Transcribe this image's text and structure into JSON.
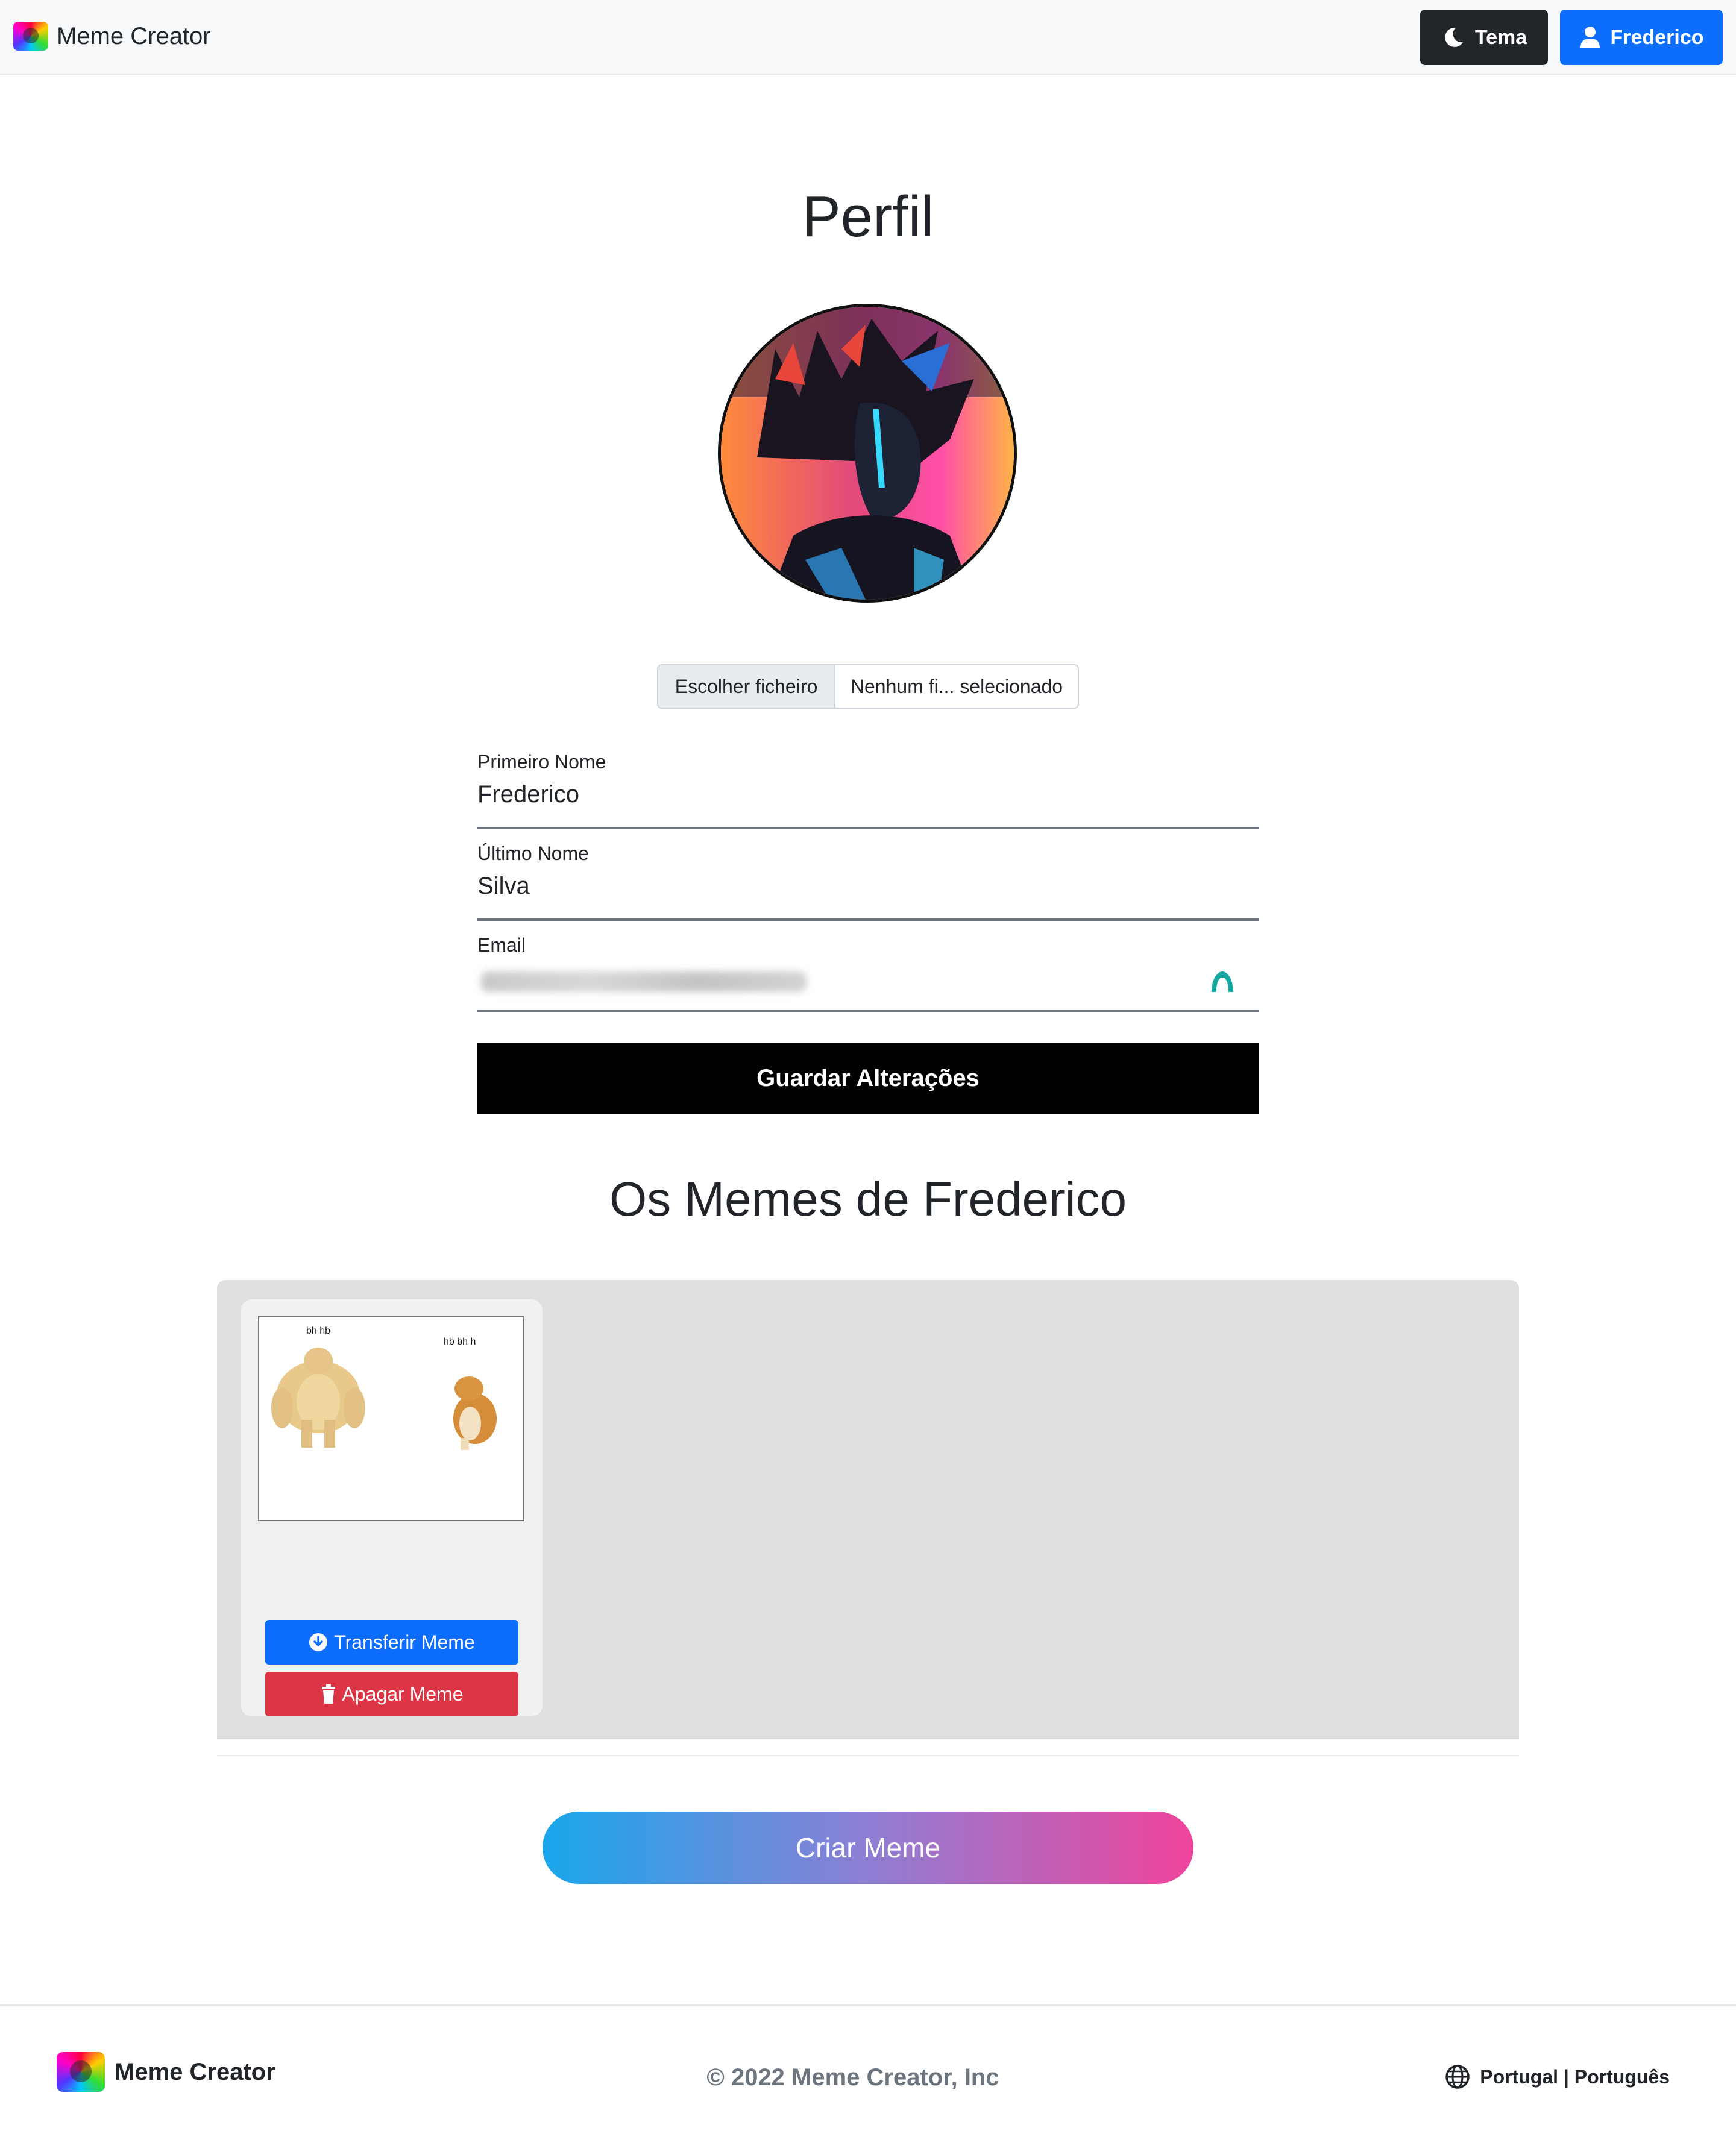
{
  "header": {
    "brand": "Meme Creator",
    "theme_label": "Tema",
    "user_label": "Frederico"
  },
  "profile": {
    "title": "Perfil",
    "file_button": "Escolher ficheiro",
    "file_status": "Nenhum fi... selecionado",
    "first_name_label": "Primeiro Nome",
    "first_name_value": "Frederico",
    "last_name_label": "Último Nome",
    "last_name_value": "Silva",
    "email_label": "Email",
    "save_label": "Guardar Alterações"
  },
  "memes": {
    "title": "Os Memes de Frederico",
    "items": [
      {
        "caption_left": "bh hb",
        "caption_right": "hb bh h",
        "download_label": "Transferir Meme",
        "delete_label": "Apagar Meme"
      }
    ]
  },
  "create_label": "Criar Meme",
  "footer": {
    "brand": "Meme Creator",
    "copyright": "© 2022 Meme Creator, Inc",
    "locale": "Portugal | Português"
  },
  "colors": {
    "primary": "#0d6efd",
    "danger": "#dc3545",
    "dark": "#212529",
    "gradient_start": "#1aa7ec",
    "gradient_end": "#f0449c"
  }
}
